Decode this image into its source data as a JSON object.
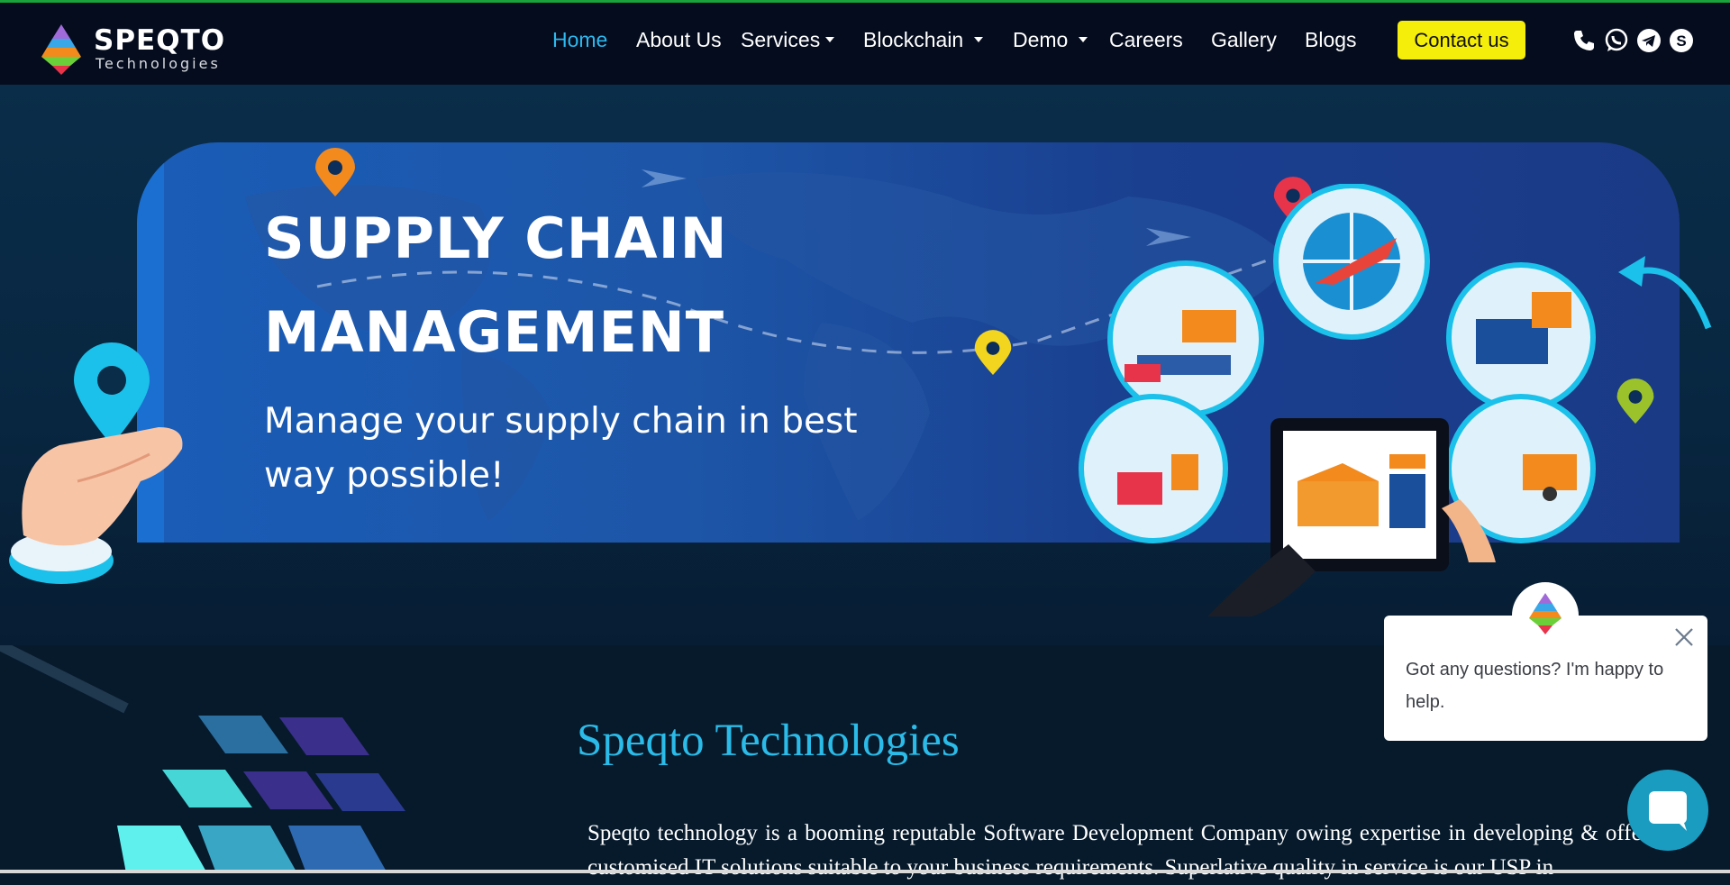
{
  "brand": {
    "name": "SPEQTO",
    "tagline": "Technologies"
  },
  "nav": {
    "items": [
      {
        "label": "Home",
        "active": true,
        "dropdown": false
      },
      {
        "label": "About Us",
        "active": false,
        "dropdown": false
      },
      {
        "label": "Services",
        "active": false,
        "dropdown": true
      },
      {
        "label": "Blockchain",
        "active": false,
        "dropdown": true
      },
      {
        "label": "Demo",
        "active": false,
        "dropdown": true
      },
      {
        "label": "Careers",
        "active": false,
        "dropdown": false
      },
      {
        "label": "Gallery",
        "active": false,
        "dropdown": false
      },
      {
        "label": "Blogs",
        "active": false,
        "dropdown": false
      }
    ],
    "contact_label": "Contact us",
    "social_icons": [
      "phone-icon",
      "whatsapp-icon",
      "telegram-icon",
      "skype-icon"
    ]
  },
  "hero": {
    "title_line1": "SUPPLY CHAIN",
    "title_line2": "MANAGEMENT",
    "subtitle": "Manage your supply chain in best way possible!"
  },
  "about": {
    "title": "Speqto Technologies",
    "text": "Speqto technology is a booming reputable Software Development Company owing expertise in developing & offering customised IT solutions suitable to your business requirements. Superlative quality in service is our USP in"
  },
  "chat": {
    "message": "Got any questions? I'm happy to help."
  },
  "colors": {
    "accent": "#2bb9f0",
    "contact_button": "#f5ee0a",
    "navbar": "#050c1e",
    "background": "#061a2c",
    "chat_button": "#1a9cc0"
  }
}
